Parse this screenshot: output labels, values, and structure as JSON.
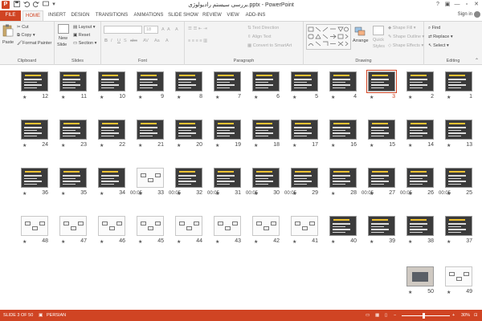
{
  "window": {
    "title": "بررسی سیستم رادیولوژی.pptx - PowerPoint",
    "app_icon": "P",
    "controls": {
      "help": "?",
      "minimize": "—",
      "restore": "▫",
      "close": "✕"
    }
  },
  "quick_access": {
    "save": "save-icon",
    "undo": "undo-icon",
    "redo": "redo-icon"
  },
  "tabs": [
    "FILE",
    "HOME",
    "INSERT",
    "DESIGN",
    "TRANSITIONS",
    "ANIMATIONS",
    "SLIDE SHOW",
    "REVIEW",
    "VIEW",
    "ADD-INS"
  ],
  "account": {
    "label": "Sign in"
  },
  "ribbon": {
    "clipboard": {
      "label": "Clipboard",
      "paste": "Paste",
      "cut": "Cut",
      "copy": "Copy",
      "format_painter": "Format Painter"
    },
    "slides": {
      "label": "Slides",
      "new_slide": "New",
      "new_slide_2": "Slide",
      "layout": "Layout",
      "reset": "Reset",
      "section": "Section"
    },
    "font": {
      "label": "Font",
      "font_name": "",
      "font_size": "18",
      "bold": "B",
      "italic": "I",
      "underline": "U",
      "shadow": "S",
      "strike": "abc",
      "grow": "A",
      "shrink": "A",
      "clear": "A",
      "case": "Aa",
      "color": "A"
    },
    "paragraph": {
      "label": "Paragraph",
      "text_direction": "Text Direction",
      "align_text": "Align Text",
      "convert_smartart": "Convert to SmartArt"
    },
    "drawing": {
      "label": "Drawing",
      "arrange": "Arrange",
      "quick_styles": "Quick",
      "quick_styles_2": "Styles",
      "shape_fill": "Shape Fill",
      "shape_outline": "Shape Outline",
      "shape_effects": "Shape Effects"
    },
    "editing": {
      "label": "Editing",
      "find": "Find",
      "replace": "Replace",
      "select": "Select"
    }
  },
  "slides": [
    {
      "n": "12"
    },
    {
      "n": "11"
    },
    {
      "n": "10"
    },
    {
      "n": "9"
    },
    {
      "n": "8"
    },
    {
      "n": "7"
    },
    {
      "n": "6"
    },
    {
      "n": "5"
    },
    {
      "n": "4"
    },
    {
      "n": "3"
    },
    {
      "n": "2"
    },
    {
      "n": "1"
    },
    {
      "n": "24"
    },
    {
      "n": "23"
    },
    {
      "n": "22"
    },
    {
      "n": "21"
    },
    {
      "n": "20"
    },
    {
      "n": "19"
    },
    {
      "n": "18"
    },
    {
      "n": "17"
    },
    {
      "n": "16"
    },
    {
      "n": "15"
    },
    {
      "n": "14"
    },
    {
      "n": "13"
    },
    {
      "n": "36"
    },
    {
      "n": "35"
    },
    {
      "n": "34"
    },
    {
      "n": "33",
      "t": "00:05"
    },
    {
      "n": "32",
      "t": "00:05"
    },
    {
      "n": "31",
      "t": "00:05"
    },
    {
      "n": "30",
      "t": "00:05"
    },
    {
      "n": "29",
      "t": "00:05"
    },
    {
      "n": "28"
    },
    {
      "n": "27",
      "t": "00:05"
    },
    {
      "n": "26",
      "t": "00:05"
    },
    {
      "n": "25",
      "t": "00:05"
    },
    {
      "n": "48"
    },
    {
      "n": "47"
    },
    {
      "n": "46"
    },
    {
      "n": "45"
    },
    {
      "n": "44"
    },
    {
      "n": "43"
    },
    {
      "n": "42"
    },
    {
      "n": "41"
    },
    {
      "n": "40"
    },
    {
      "n": "39"
    },
    {
      "n": "38"
    },
    {
      "n": "37"
    },
    {
      "n": "50"
    },
    {
      "n": "49"
    }
  ],
  "selected_slide": "3",
  "star": "★",
  "status": {
    "slide_info": "SLIDE 3 OF 50",
    "language": "PERSIAN",
    "zoom": "30%",
    "minus": "−",
    "plus": "+"
  },
  "colors": {
    "accent": "#d04423",
    "ribbon_bg": "#f3f3f3",
    "slide_dark": "#3b3b3b",
    "title_yellow": "#f1c232"
  }
}
